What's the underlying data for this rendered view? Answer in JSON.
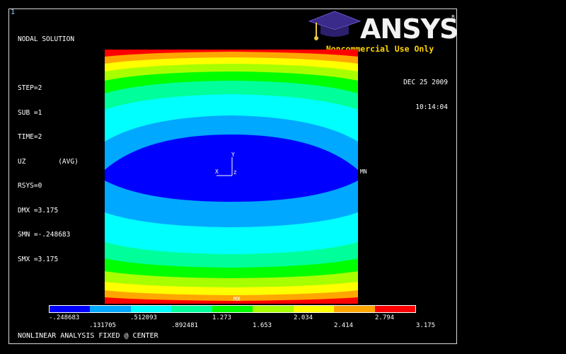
{
  "window": {
    "number": "1"
  },
  "info": {
    "lines": [
      "NODAL SOLUTION",
      "",
      "STEP=2",
      "SUB =1",
      "TIME=2",
      "UZ        (AVG)",
      "RSYS=0",
      "DMX =3.175",
      "SMN =-.248683",
      "SMX =3.175"
    ]
  },
  "datetime": {
    "date": "DEC 25 2009",
    "time": "10:14:04"
  },
  "logo": {
    "word": "ANSYS",
    "reg": "R",
    "subtitle": "Noncommercial Use Only"
  },
  "plot": {
    "mn_label": "MN",
    "mx_label": "MX"
  },
  "triad": {
    "x": "X",
    "y": "Y",
    "z": "Z"
  },
  "legend": {
    "colors": [
      "#0000ff",
      "#00a8ff",
      "#00ffff",
      "#00ff9a",
      "#00ff00",
      "#a8ff00",
      "#ffff00",
      "#ffa600",
      "#ff0000"
    ],
    "labels_top": [
      "-.248683",
      ".512093",
      "1.273",
      "2.034",
      "2.794"
    ],
    "labels_bottom": [
      ".131705",
      ".892481",
      "1.653",
      "2.414",
      "3.175"
    ]
  },
  "footer": {
    "title": "NONLINEAR ANALYSIS FIXED @ CENTER"
  }
}
